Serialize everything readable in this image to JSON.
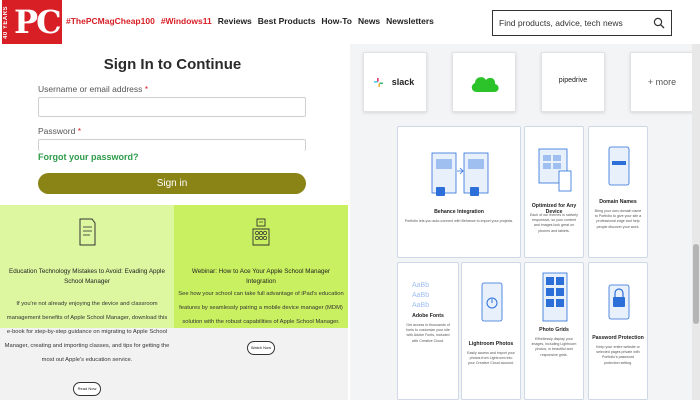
{
  "header": {
    "logo_text": "PC",
    "logo_years": "40 YEARS",
    "nav_tags": [
      "#ThePCMagCheap100",
      "#Windows11"
    ],
    "nav_links": [
      "Reviews",
      "Best Products",
      "How-To",
      "News",
      "Newsletters"
    ],
    "search_placeholder": "Find products, advice, tech news"
  },
  "login": {
    "title": "Sign In to Continue",
    "username_label": "Username or email address",
    "password_label": "Password",
    "required_mark": "*",
    "forgot_link": "Forgot your password?",
    "signin_button": "Sign in"
  },
  "promos": [
    {
      "title": "Education Technology Mistakes to Avoid: Evading Apple School Manager",
      "body": "If you're not already enjoying the device and classroom management benefits of Apple School Manager, download this e-book for step-by-step guidance on migrating to Apple School Manager, creating and importing classes, and tips for getting the most out Apple's education service.",
      "button": "Read Now",
      "icon": "book-icon"
    },
    {
      "title": "Webinar: How to Ace Your Apple School Manager Integration",
      "body": "See how your school can take full advantage of iPad's education features by seamlessly pairing a mobile device manager (MDM) solution with the robust capabilities of Apple School Manager.",
      "button": "Watch Now",
      "icon": "stack-icon"
    }
  ],
  "integrations": [
    {
      "label": "slack",
      "icon": "slack-icon"
    },
    {
      "label": "",
      "icon": "cloud-icon"
    },
    {
      "label": "pipedrive",
      "icon": "pipedrive-icon"
    },
    {
      "label": "+ more",
      "icon": "more-icon"
    }
  ],
  "features": [
    {
      "name": "Behance Integration",
      "desc": "Portfolio lets you auto-connect with Behance to import your projects."
    },
    {
      "name": "Optimized for Any Device",
      "desc": "Each of our themes is natively responsive, so your content and images look great on phones and tablets."
    },
    {
      "name": "Domain Names",
      "desc": "Bring your own domain name to Portfolio to give your site a professional edge and help people discover your work."
    },
    {
      "name": "Adobe Fonts",
      "desc": "Get access to thousands of fonts to customize your site with Adobe Fonts, included with Creative Cloud."
    },
    {
      "name": "Lightroom Photos",
      "desc": "Easily access and import your photos from Lightroom into your Creative Cloud account."
    },
    {
      "name": "Photo Grids",
      "desc": "Effortlessly display your images, including Lightroom photos, in beautiful and responsive grids."
    },
    {
      "name": "Password Protection",
      "desc": "Keep your entire website or selected pages private with Portfolio's password protection setting."
    }
  ],
  "colors": {
    "brand_red": "#d81f26",
    "signin_olive": "#8a8316",
    "link_green": "#2e9b4a",
    "promo_light": "#ddf7a0",
    "promo_lime": "#c8f060",
    "feature_blue": "#2c6fd8"
  }
}
